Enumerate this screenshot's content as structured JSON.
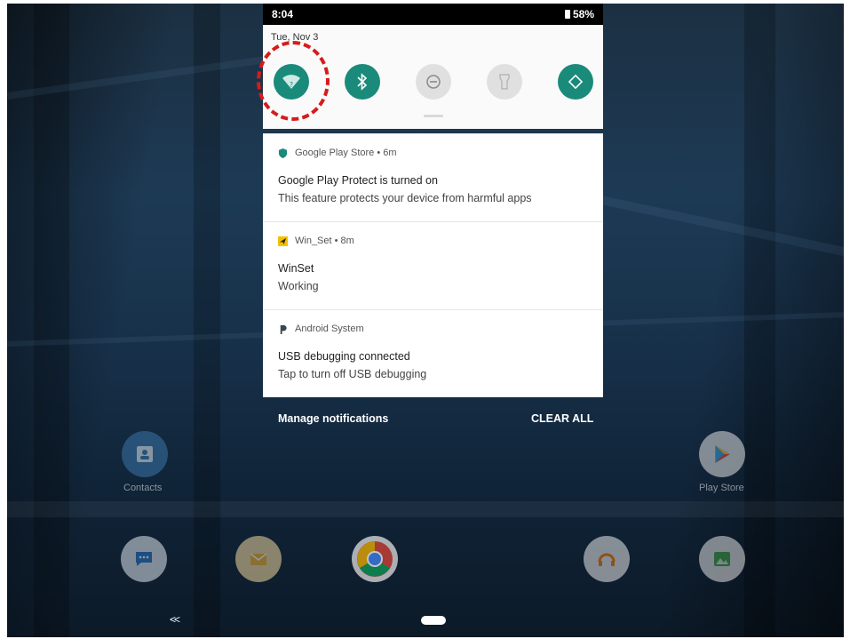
{
  "status_bar": {
    "time": "8:04",
    "battery": "58%"
  },
  "quick_settings": {
    "date": "Tue, Nov 3",
    "tiles": [
      {
        "name": "wifi",
        "icon": "wifi-unknown-icon",
        "state": "on"
      },
      {
        "name": "bluetooth",
        "icon": "bluetooth-icon",
        "state": "on"
      },
      {
        "name": "do-not-disturb",
        "icon": "dnd-icon",
        "state": "off"
      },
      {
        "name": "flashlight",
        "icon": "flashlight-icon",
        "state": "off"
      },
      {
        "name": "auto-rotate",
        "icon": "rotate-icon",
        "state": "on"
      }
    ],
    "accent_color": "#1a8a7b",
    "highlight_color": "#d71b1b"
  },
  "notifications": [
    {
      "app": "Google Play Store • 6m",
      "title": "Google Play Protect is turned on",
      "text": "This feature protects your device from harmful apps",
      "icon": "shield-icon"
    },
    {
      "app": "Win_Set • 8m",
      "title": "WinSet",
      "text": "Working",
      "icon": "winset-icon"
    },
    {
      "app": "Android System",
      "title": "USB debugging connected",
      "text": "Tap to turn off USB debugging",
      "icon": "android-system-icon"
    }
  ],
  "footer": {
    "manage": "Manage notifications",
    "clear_all": "CLEAR ALL"
  },
  "home": {
    "labels": {
      "contacts": "Contacts",
      "play_store": "Play Store"
    },
    "apps": [
      "contacts-icon",
      "play-store-icon",
      "messages-icon",
      "email-icon",
      "chrome-icon",
      "music-icon",
      "gallery-icon"
    ]
  },
  "nav": {
    "back": "<<"
  }
}
